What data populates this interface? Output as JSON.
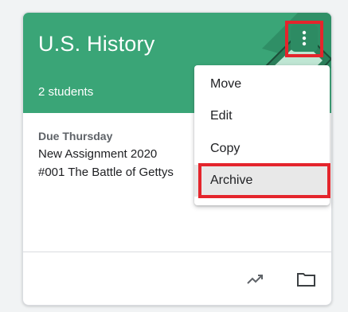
{
  "class_card": {
    "title": "U.S. History",
    "student_count": "2 students",
    "due_label": "Due Thursday",
    "assignment_lines": [
      "New Assignment 2020",
      "#001 The Battle of Gettys"
    ]
  },
  "menu": {
    "items": [
      {
        "label": "Move"
      },
      {
        "label": "Edit"
      },
      {
        "label": "Copy"
      },
      {
        "label": "Archive"
      }
    ]
  },
  "icons": {
    "more": "more-vert-icon",
    "insights": "trending-up-icon",
    "folder": "folder-icon"
  },
  "colors": {
    "header": "#3aa577",
    "highlight": "#e4252c",
    "menu_active": "#e8e8e8"
  }
}
